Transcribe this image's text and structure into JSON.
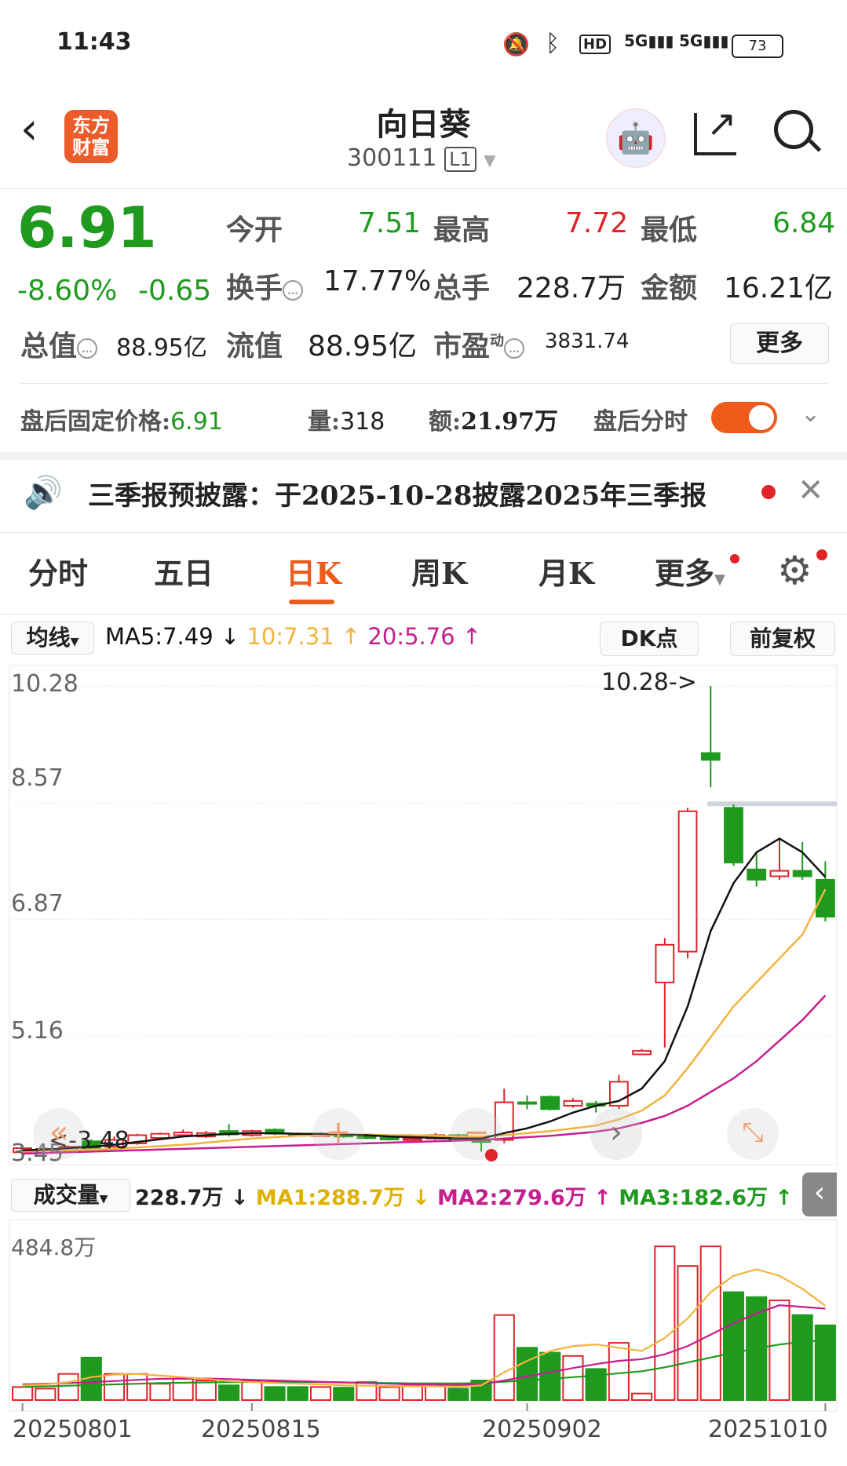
{
  "status_bar": {
    "time": "11:43",
    "battery": "73"
  },
  "header": {
    "logo_text": "东方财富",
    "stock_name": "向日葵",
    "stock_code": "300111",
    "level_badge": "L1"
  },
  "quote": {
    "price": "6.91",
    "change_pct": "-8.60%",
    "change_abs": "-0.65",
    "open_label": "今开",
    "open_value": "7.51",
    "high_label": "最高",
    "high_value": "7.72",
    "low_label": "最低",
    "low_value": "6.84",
    "turnover_label": "换手",
    "turnover_value": "17.77%",
    "volume_label": "总手",
    "volume_value": "228.7万",
    "amount_label": "金额",
    "amount_value": "16.21亿",
    "mktcap_label": "总值",
    "mktcap_value": "88.95亿",
    "float_label": "流值",
    "float_value": "88.95亿",
    "pe_label": "市盈",
    "pe_superscript": "动",
    "pe_value": "3831.74",
    "more_button": "更多"
  },
  "after_hours": {
    "price_label": "盘后固定价格:",
    "price_value": "6.91",
    "volume_label": "量:",
    "volume_value": "318",
    "amount_label": "额:",
    "amount_value": "21.97万",
    "timeshare_label": "盘后分时"
  },
  "notice": {
    "text": "三季报预披露：于2025-10-28披露2025年三季报"
  },
  "tabs": [
    "分时",
    "五日",
    "日K",
    "周K",
    "月K",
    "更多"
  ],
  "active_tab": "日K",
  "ma_bar": {
    "selector": "均线",
    "ma5": "MA5:7.49",
    "ma5_arrow": "↓",
    "ma10": "10:7.31",
    "ma10_arrow": "↑",
    "ma20": "20:5.76",
    "ma20_arrow": "↑",
    "dk_button": "DK点",
    "adjust_button": "前复权"
  },
  "volume_bar": {
    "selector": "成交量",
    "value": "228.7万",
    "value_arrow": "↓",
    "ma1": "MA1:288.7万",
    "ma1_arrow": "↓",
    "ma2": "MA2:279.6万",
    "ma2_arrow": "↑",
    "ma3": "MA3:182.6万",
    "ma3_arrow": "↑"
  },
  "colors": {
    "up": "#e0242a",
    "down": "#1f9a1f",
    "accent": "#ef5a1a",
    "ma5": "#111111",
    "ma10": "#f3b33d",
    "ma20": "#c61d8f"
  },
  "chart_data": {
    "type": "candlestick",
    "y_ticks": [
      "10.28",
      "8.57",
      "6.87",
      "5.16",
      "3.45"
    ],
    "ylim": [
      3.45,
      10.28
    ],
    "max_annotation": "10.28->",
    "min_annotation": "<-3.48",
    "x_tick_labels": [
      "20250801",
      "20250815",
      "20250902",
      "20251010"
    ],
    "candles": [
      {
        "o": 3.47,
        "c": 3.53,
        "h": 3.55,
        "l": 3.45
      },
      {
        "o": 3.5,
        "c": 3.52,
        "h": 3.54,
        "l": 3.48
      },
      {
        "o": 3.49,
        "c": 3.55,
        "h": 3.57,
        "l": 3.48
      },
      {
        "o": 3.63,
        "c": 3.53,
        "h": 3.66,
        "l": 3.52
      },
      {
        "o": 3.55,
        "c": 3.65,
        "h": 3.7,
        "l": 3.54
      },
      {
        "o": 3.6,
        "c": 3.72,
        "h": 3.74,
        "l": 3.58
      },
      {
        "o": 3.68,
        "c": 3.74,
        "h": 3.76,
        "l": 3.66
      },
      {
        "o": 3.72,
        "c": 3.76,
        "h": 3.8,
        "l": 3.7
      },
      {
        "o": 3.7,
        "c": 3.75,
        "h": 3.78,
        "l": 3.68
      },
      {
        "o": 3.78,
        "c": 3.73,
        "h": 3.88,
        "l": 3.7
      },
      {
        "o": 3.72,
        "c": 3.78,
        "h": 3.8,
        "l": 3.7
      },
      {
        "o": 3.8,
        "c": 3.74,
        "h": 3.82,
        "l": 3.72
      },
      {
        "o": 3.74,
        "c": 3.72,
        "h": 3.76,
        "l": 3.7
      },
      {
        "o": 3.72,
        "c": 3.73,
        "h": 3.76,
        "l": 3.7
      },
      {
        "o": 3.73,
        "c": 3.7,
        "h": 3.75,
        "l": 3.68
      },
      {
        "o": 3.7,
        "c": 3.68,
        "h": 3.72,
        "l": 3.66
      },
      {
        "o": 3.68,
        "c": 3.66,
        "h": 3.7,
        "l": 3.64
      },
      {
        "o": 3.66,
        "c": 3.67,
        "h": 3.69,
        "l": 3.64
      },
      {
        "o": 3.67,
        "c": 3.72,
        "h": 3.75,
        "l": 3.65
      },
      {
        "o": 3.72,
        "c": 3.66,
        "h": 3.74,
        "l": 3.64
      },
      {
        "o": 3.66,
        "c": 3.62,
        "h": 3.68,
        "l": 3.48
      },
      {
        "o": 3.65,
        "c": 4.2,
        "h": 4.4,
        "l": 3.6
      },
      {
        "o": 4.2,
        "c": 4.18,
        "h": 4.3,
        "l": 4.1
      },
      {
        "o": 4.28,
        "c": 4.1,
        "h": 4.3,
        "l": 4.08
      },
      {
        "o": 4.15,
        "c": 4.22,
        "h": 4.26,
        "l": 4.12
      },
      {
        "o": 4.18,
        "c": 4.15,
        "h": 4.22,
        "l": 4.05
      },
      {
        "o": 4.15,
        "c": 4.5,
        "h": 4.6,
        "l": 4.1
      },
      {
        "o": 4.9,
        "c": 4.95,
        "h": 4.98,
        "l": 4.92
      },
      {
        "o": 5.95,
        "c": 6.5,
        "h": 6.6,
        "l": 5.0
      },
      {
        "o": 6.4,
        "c": 8.45,
        "h": 8.5,
        "l": 6.3
      },
      {
        "o": 9.3,
        "c": 9.2,
        "h": 10.28,
        "l": 8.8
      },
      {
        "o": 8.5,
        "c": 7.7,
        "h": 8.55,
        "l": 7.65
      },
      {
        "o": 7.6,
        "c": 7.45,
        "h": 7.85,
        "l": 7.35
      },
      {
        "o": 7.5,
        "c": 7.58,
        "h": 8.05,
        "l": 7.45
      },
      {
        "o": 7.58,
        "c": 7.5,
        "h": 8.0,
        "l": 7.45
      },
      {
        "o": 7.45,
        "c": 6.91,
        "h": 7.72,
        "l": 6.84
      }
    ],
    "ma5": [
      3.5,
      3.51,
      3.53,
      3.55,
      3.58,
      3.62,
      3.66,
      3.7,
      3.72,
      3.74,
      3.75,
      3.75,
      3.74,
      3.74,
      3.73,
      3.72,
      3.7,
      3.69,
      3.68,
      3.67,
      3.67,
      3.75,
      3.82,
      3.92,
      4.05,
      4.15,
      4.22,
      4.4,
      4.8,
      5.6,
      6.7,
      7.4,
      7.85,
      8.05,
      7.85,
      7.49
    ],
    "ma10": [
      3.48,
      3.49,
      3.5,
      3.51,
      3.52,
      3.54,
      3.56,
      3.58,
      3.61,
      3.64,
      3.67,
      3.69,
      3.71,
      3.72,
      3.73,
      3.73,
      3.72,
      3.72,
      3.71,
      3.7,
      3.7,
      3.72,
      3.75,
      3.78,
      3.82,
      3.86,
      3.95,
      4.08,
      4.3,
      4.7,
      5.15,
      5.6,
      5.95,
      6.3,
      6.65,
      7.31
    ],
    "ma20": [
      3.45,
      3.46,
      3.47,
      3.48,
      3.49,
      3.5,
      3.51,
      3.52,
      3.53,
      3.54,
      3.55,
      3.56,
      3.57,
      3.58,
      3.59,
      3.6,
      3.61,
      3.62,
      3.63,
      3.64,
      3.65,
      3.67,
      3.69,
      3.71,
      3.74,
      3.77,
      3.82,
      3.9,
      4.0,
      4.15,
      4.35,
      4.55,
      4.8,
      5.1,
      5.4,
      5.76
    ],
    "volume_ylabel": "484.8万",
    "volume": [
      40,
      35,
      80,
      130,
      80,
      80,
      50,
      65,
      60,
      45,
      60,
      40,
      40,
      40,
      38,
      55,
      40,
      45,
      42,
      35,
      60,
      260,
      160,
      145,
      135,
      95,
      175,
      20,
      470,
      410,
      470,
      330,
      315,
      305,
      260,
      228.7
    ],
    "volume_up": [
      true,
      true,
      true,
      false,
      true,
      true,
      true,
      true,
      true,
      false,
      true,
      false,
      false,
      true,
      false,
      true,
      true,
      true,
      true,
      false,
      false,
      true,
      false,
      false,
      true,
      false,
      true,
      true,
      true,
      true,
      true,
      false,
      false,
      true,
      false,
      false
    ],
    "vol_ma1": [
      45,
      48,
      55,
      70,
      78,
      80,
      75,
      70,
      65,
      58,
      55,
      52,
      50,
      48,
      45,
      44,
      43,
      42,
      42,
      40,
      45,
      85,
      120,
      150,
      165,
      170,
      160,
      150,
      190,
      250,
      330,
      380,
      400,
      380,
      340,
      288.7
    ],
    "vol_ma2": [
      48,
      50,
      52,
      55,
      58,
      62,
      65,
      66,
      66,
      64,
      62,
      60,
      58,
      56,
      54,
      52,
      50,
      48,
      47,
      46,
      48,
      60,
      72,
      85,
      98,
      110,
      120,
      125,
      140,
      165,
      200,
      235,
      265,
      290,
      285,
      279.6
    ],
    "vol_ma3": [
      40,
      42,
      44,
      46,
      48,
      50,
      52,
      53,
      54,
      55,
      55,
      55,
      55,
      55,
      54,
      53,
      52,
      51,
      51,
      51,
      52,
      56,
      60,
      65,
      70,
      75,
      82,
      88,
      100,
      115,
      130,
      145,
      158,
      170,
      178,
      182.6
    ]
  }
}
